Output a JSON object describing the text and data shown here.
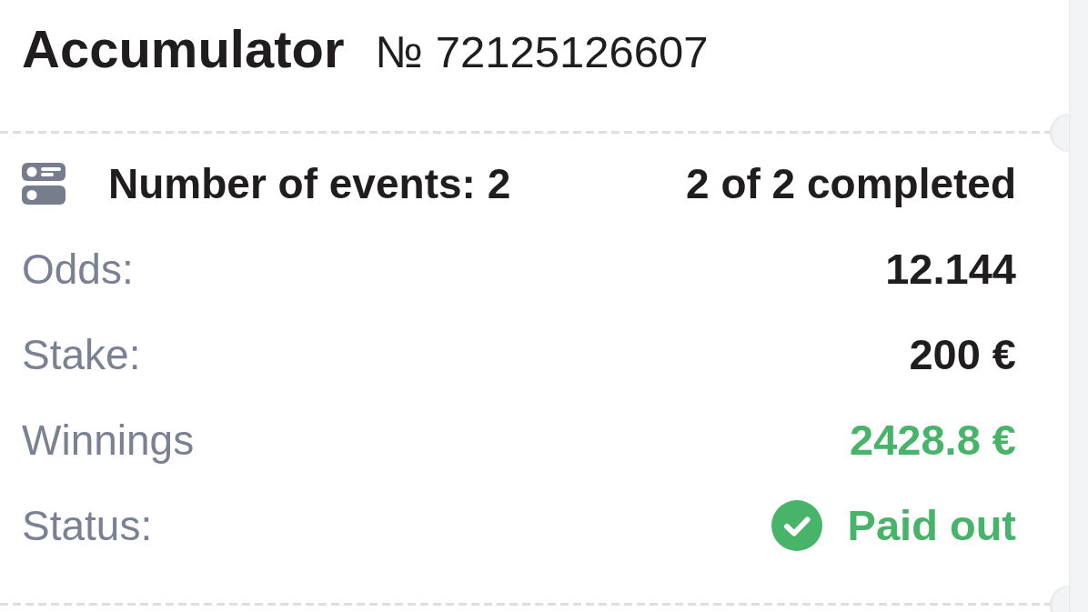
{
  "bet": {
    "type": "Accumulator",
    "number": "№ 72125126607"
  },
  "events": {
    "label": "Number of events: 2",
    "summary": "2 of 2 completed"
  },
  "details": [
    {
      "kind": "plain",
      "label": "Odds:",
      "value": "12.144"
    },
    {
      "kind": "plain",
      "label": "Stake:",
      "value": "200 €"
    },
    {
      "kind": "positive",
      "label": "Winnings",
      "value": "2428.8 €"
    },
    {
      "kind": "status",
      "label": "Status:",
      "value": "Paid out"
    }
  ]
}
